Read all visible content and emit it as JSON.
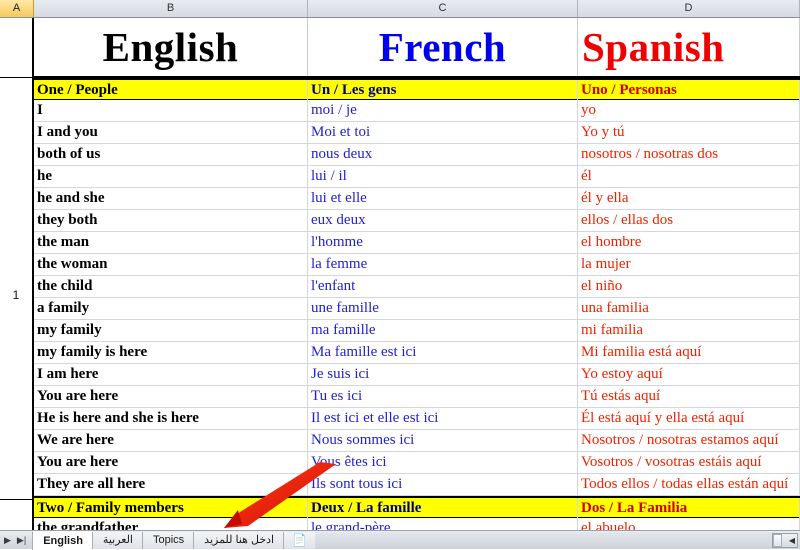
{
  "app": {
    "type": "spreadsheet",
    "selected_column": "A",
    "visible_row_number": "1"
  },
  "columns": {
    "headers": [
      "A",
      "B",
      "C",
      "D"
    ]
  },
  "titles": {
    "english": "English",
    "french": "French",
    "spanish": "Spanish",
    "english_color": "#000000",
    "french_color": "#0000f0",
    "spanish_color": "#f00000"
  },
  "table": {
    "rows": [
      {
        "type": "section",
        "english": "One / People",
        "french": "Un / Les gens",
        "spanish": "Uno / Personas"
      },
      {
        "type": "entry",
        "english": "I",
        "french": "moi / je",
        "spanish": "yo"
      },
      {
        "type": "entry",
        "english": "I and you",
        "french": "Moi et toi",
        "spanish": "Yo y tú"
      },
      {
        "type": "entry",
        "english": "both of us",
        "french": "nous deux",
        "spanish": "nosotros / nosotras dos"
      },
      {
        "type": "entry",
        "english": "he",
        "french": "lui / il",
        "spanish": "él"
      },
      {
        "type": "entry",
        "english": "he and she",
        "french": "lui et elle",
        "spanish": "él y ella"
      },
      {
        "type": "entry",
        "english": "they both",
        "french": "eux deux",
        "spanish": "ellos / ellas dos"
      },
      {
        "type": "entry",
        "english": "the man",
        "french": "l'homme",
        "spanish": "el hombre"
      },
      {
        "type": "entry",
        "english": "the woman",
        "french": "la femme",
        "spanish": "la mujer"
      },
      {
        "type": "entry",
        "english": "the child",
        "french": "l'enfant",
        "spanish": "el niño"
      },
      {
        "type": "entry",
        "english": "a family",
        "french": "une famille",
        "spanish": "una familia"
      },
      {
        "type": "entry",
        "english": "my family",
        "french": "ma famille",
        "spanish": "mi familia"
      },
      {
        "type": "entry",
        "english": "my family is here",
        "french": "Ma famille est ici",
        "spanish": "Mi familia está aquí"
      },
      {
        "type": "entry",
        "english": "I am here",
        "french": "Je suis ici",
        "spanish": "Yo estoy aquí"
      },
      {
        "type": "entry",
        "english": "You are here",
        "french": "Tu es ici",
        "spanish": "Tú estás aquí"
      },
      {
        "type": "entry",
        "english": "He is here and she is here",
        "french": "Il est ici et elle est ici",
        "spanish": "Él está aquí y ella está aquí"
      },
      {
        "type": "entry",
        "english": "We are here",
        "french": "Nous sommes ici",
        "spanish": "Nosotros / nosotras estamos aquí"
      },
      {
        "type": "entry",
        "english": "You are here",
        "french": "Vous êtes ici",
        "spanish": "Vosotros / vosotras estáis aquí"
      },
      {
        "type": "entry",
        "english": "They are all here",
        "french": "Ils sont tous ici",
        "spanish": "Todos ellos / todas ellas están aquí"
      },
      {
        "type": "section",
        "english": "Two / Family members",
        "french": "Deux / La famille",
        "spanish": "Dos / La Familia"
      },
      {
        "type": "entry",
        "english": "the grandfather",
        "french": "le grand-père",
        "spanish": "el abuelo"
      }
    ]
  },
  "annotation": {
    "arrow_color": "#ee1100"
  },
  "sheet_tabs": {
    "nav_first": "◀",
    "nav_prev": "▶",
    "nav_next": "▶|",
    "items": [
      {
        "label": "English",
        "active": true,
        "rtl": false
      },
      {
        "label": "العربية",
        "active": false,
        "rtl": true
      },
      {
        "label": "Topics",
        "active": false,
        "rtl": false
      },
      {
        "label": "ادخل هنا للمزيد",
        "active": false,
        "rtl": true
      }
    ],
    "new_sheet_icon": "new-sheet-icon"
  }
}
